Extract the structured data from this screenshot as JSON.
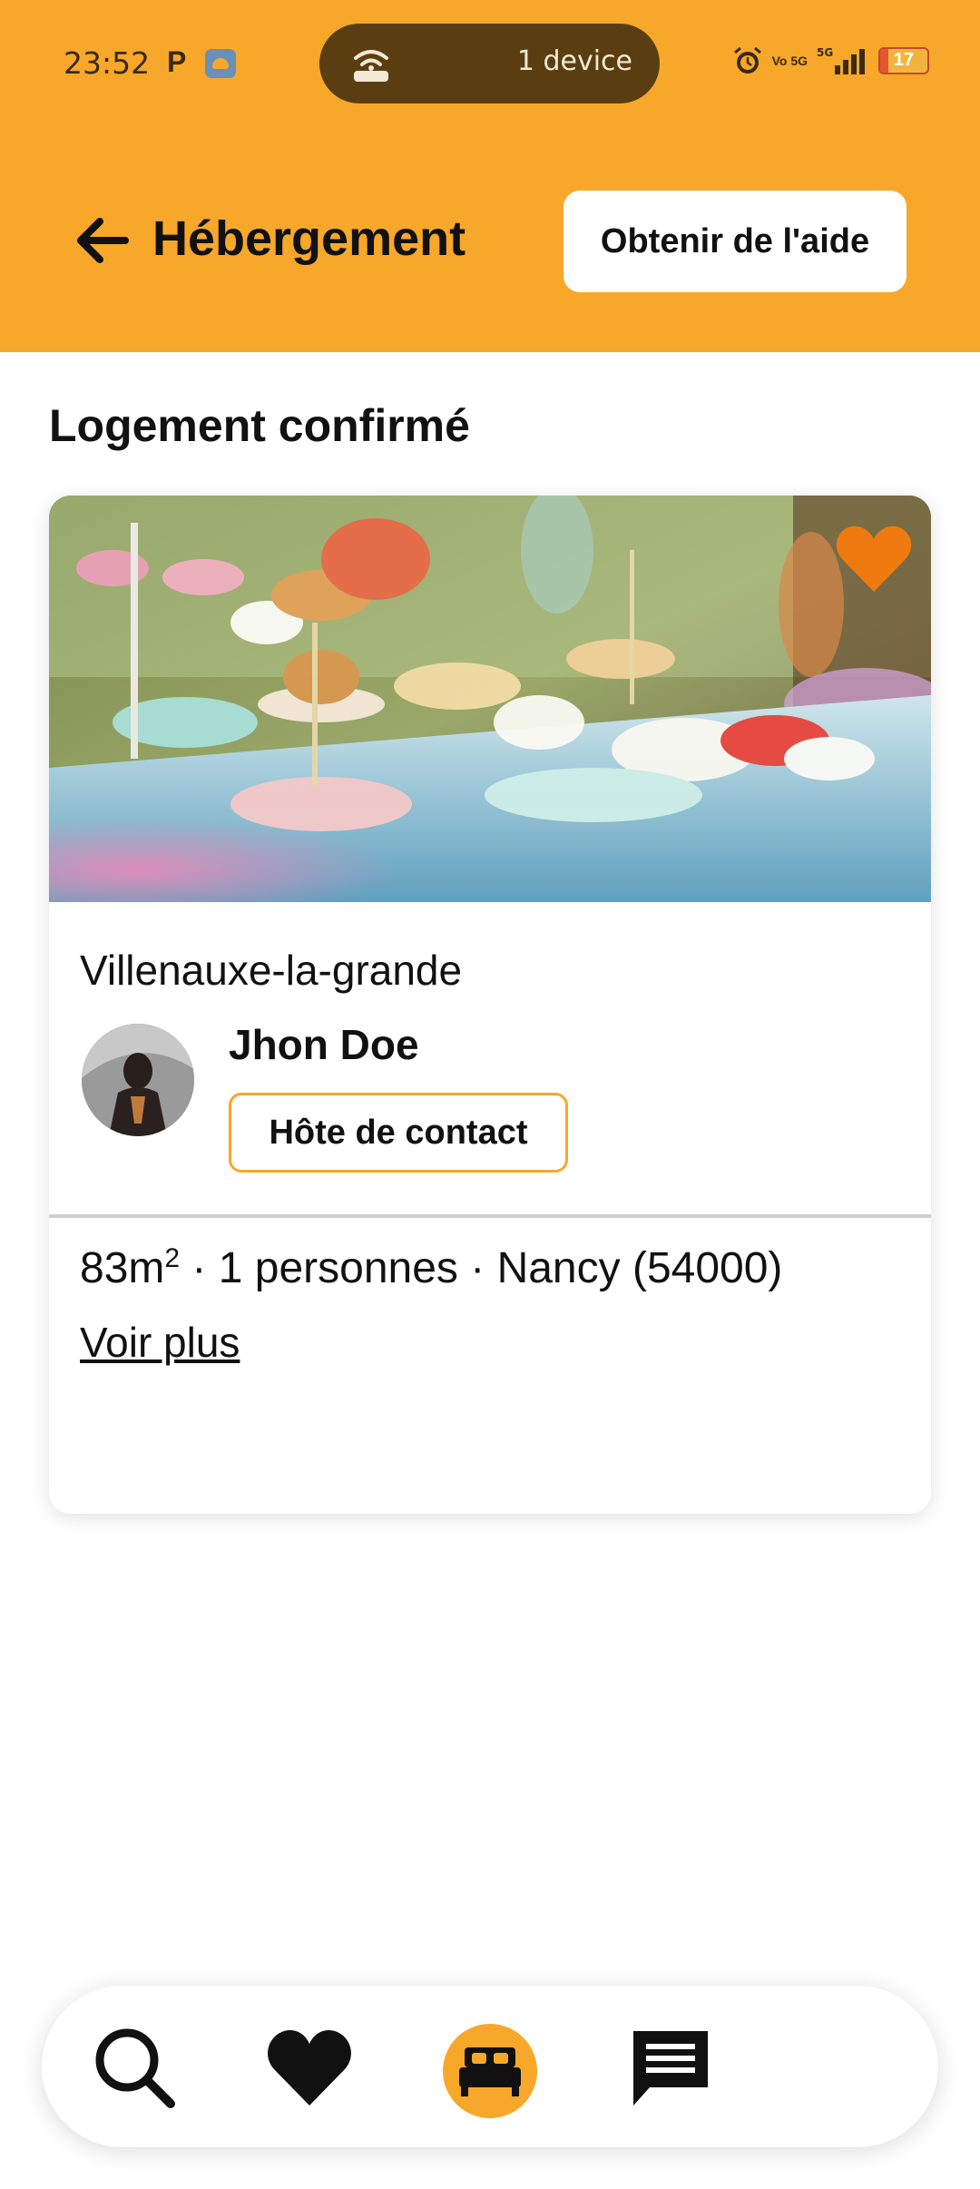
{
  "status_bar": {
    "time": "23:52",
    "notification_letter": "P",
    "hotspot_label": "1 device",
    "network": "5G",
    "volte": "Vo 5G",
    "battery_level": "17",
    "battery_fraction": 0.17
  },
  "header": {
    "back_icon": "arrow-left-icon",
    "title": "Hébergement",
    "help_button_label": "Obtenir de l'aide"
  },
  "main": {
    "section_title": "Logement confirmé",
    "card": {
      "location": "Villenauxe-la-grande",
      "host_name": "Jhon Doe",
      "contact_button_label": "Hôte de contact",
      "details_area": "83m",
      "details_area_sup": "2",
      "details_rest": " · 1 personnes · Nancy (54000)",
      "see_more_label": "Voir plus",
      "favorite_icon": "heart-icon",
      "favorite_color": "#EE7A10"
    }
  },
  "bottom_nav": {
    "items": [
      {
        "icon": "search-icon",
        "active": false
      },
      {
        "icon": "heart-icon",
        "active": false
      },
      {
        "icon": "bed-icon",
        "active": true
      },
      {
        "icon": "chat-icon",
        "active": false
      }
    ],
    "active_color": "#F7A82A"
  },
  "colors": {
    "brand": "#F7A82A",
    "status_pill": "#5A3E12",
    "text": "#111111"
  }
}
